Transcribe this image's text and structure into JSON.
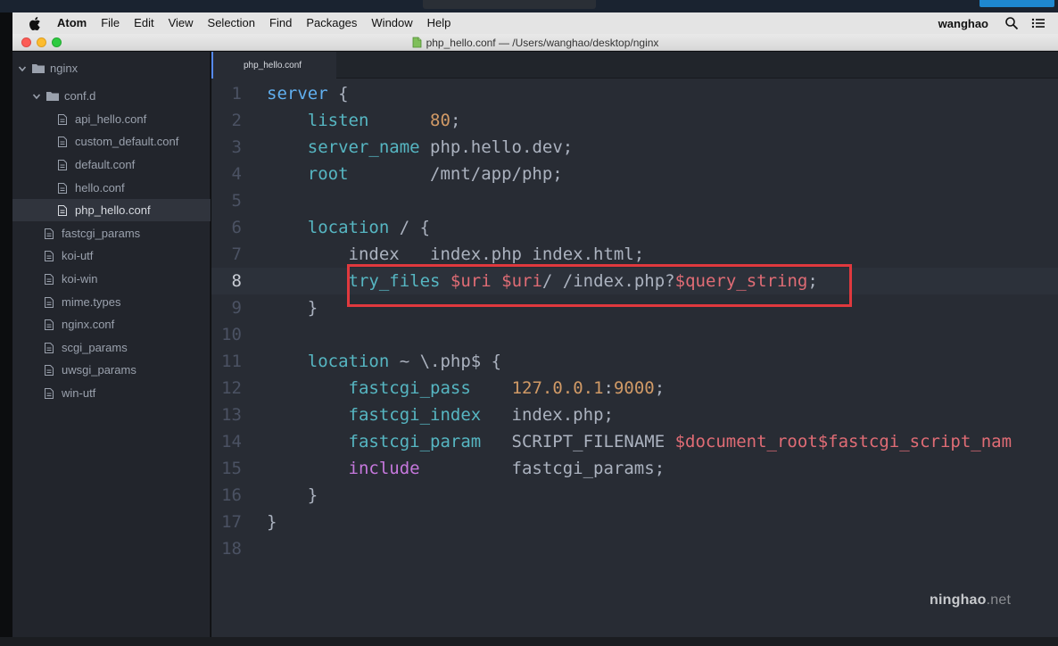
{
  "menubar": {
    "app_name": "Atom",
    "menus": [
      "File",
      "Edit",
      "View",
      "Selection",
      "Find",
      "Packages",
      "Window",
      "Help"
    ],
    "user": "wanghao",
    "icons": [
      "apple-icon",
      "search-icon",
      "list-icon"
    ]
  },
  "window": {
    "title": "php_hello.conf — /Users/wanghao/desktop/nginx"
  },
  "tree": {
    "root": "nginx",
    "folder": "conf.d",
    "conf_d_files": [
      "api_hello.conf",
      "custom_default.conf",
      "default.conf",
      "hello.conf",
      "php_hello.conf"
    ],
    "selected": "php_hello.conf",
    "root_files": [
      "fastcgi_params",
      "koi-utf",
      "koi-win",
      "mime.types",
      "nginx.conf",
      "scgi_params",
      "uwsgi_params",
      "win-utf"
    ]
  },
  "editor": {
    "tab_title": "php_hello.conf",
    "current_line": 8,
    "highlighted_line": 8,
    "colors": {
      "keyword": "#61afef",
      "directive": "#56b6c2",
      "number": "#d19a66",
      "variable": "#e06c75",
      "include": "#c678dd",
      "plain": "#abb2bf",
      "highlight_box": "#e0393e"
    },
    "lines": [
      {
        "n": "1",
        "tokens": [
          [
            "k-blue",
            "server"
          ],
          [
            "k-plain",
            " {"
          ]
        ]
      },
      {
        "n": "2",
        "tokens": [
          [
            "k-plain",
            "    "
          ],
          [
            "k-cyan",
            "listen"
          ],
          [
            "k-plain",
            "      "
          ],
          [
            "k-orange",
            "80"
          ],
          [
            "k-plain",
            ";"
          ]
        ]
      },
      {
        "n": "3",
        "tokens": [
          [
            "k-plain",
            "    "
          ],
          [
            "k-cyan",
            "server_name"
          ],
          [
            "k-plain",
            " php.hello.dev;"
          ]
        ]
      },
      {
        "n": "4",
        "tokens": [
          [
            "k-plain",
            "    "
          ],
          [
            "k-cyan",
            "root"
          ],
          [
            "k-plain",
            "        /mnt/app/php;"
          ]
        ]
      },
      {
        "n": "5",
        "tokens": []
      },
      {
        "n": "6",
        "tokens": [
          [
            "k-plain",
            "    "
          ],
          [
            "k-cyan",
            "location"
          ],
          [
            "k-plain",
            " / {"
          ]
        ]
      },
      {
        "n": "7",
        "tokens": [
          [
            "k-plain",
            "        index   index.php index.html;"
          ]
        ]
      },
      {
        "n": "8",
        "tokens": [
          [
            "k-plain",
            "        "
          ],
          [
            "k-cyan",
            "try_files"
          ],
          [
            "k-plain",
            " "
          ],
          [
            "k-red",
            "$uri"
          ],
          [
            "k-plain",
            " "
          ],
          [
            "k-red",
            "$uri"
          ],
          [
            "k-plain",
            "/ /index.php?"
          ],
          [
            "k-red",
            "$query_string"
          ],
          [
            "k-plain",
            ";"
          ]
        ]
      },
      {
        "n": "9",
        "tokens": [
          [
            "k-plain",
            "    }"
          ]
        ]
      },
      {
        "n": "10",
        "tokens": []
      },
      {
        "n": "11",
        "tokens": [
          [
            "k-plain",
            "    "
          ],
          [
            "k-cyan",
            "location"
          ],
          [
            "k-plain",
            " ~ \\.php$ {"
          ]
        ]
      },
      {
        "n": "12",
        "tokens": [
          [
            "k-plain",
            "        "
          ],
          [
            "k-cyan",
            "fastcgi_pass"
          ],
          [
            "k-plain",
            "    "
          ],
          [
            "k-orange",
            "127.0.0.1"
          ],
          [
            "k-plain",
            ":"
          ],
          [
            "k-orange",
            "9000"
          ],
          [
            "k-plain",
            ";"
          ]
        ]
      },
      {
        "n": "13",
        "tokens": [
          [
            "k-plain",
            "        "
          ],
          [
            "k-cyan",
            "fastcgi_index"
          ],
          [
            "k-plain",
            "   index.php;"
          ]
        ]
      },
      {
        "n": "14",
        "tokens": [
          [
            "k-plain",
            "        "
          ],
          [
            "k-cyan",
            "fastcgi_param"
          ],
          [
            "k-plain",
            "   SCRIPT_FILENAME "
          ],
          [
            "k-red",
            "$document_root$fastcgi_script_nam"
          ]
        ]
      },
      {
        "n": "15",
        "tokens": [
          [
            "k-plain",
            "        "
          ],
          [
            "k-purple",
            "include"
          ],
          [
            "k-plain",
            "         fastcgi_params;"
          ]
        ]
      },
      {
        "n": "16",
        "tokens": [
          [
            "k-plain",
            "    }"
          ]
        ]
      },
      {
        "n": "17",
        "tokens": [
          [
            "k-plain",
            "}"
          ]
        ]
      },
      {
        "n": "18",
        "tokens": []
      }
    ]
  },
  "watermark": {
    "brand": "ninghao",
    "suffix": ".net"
  }
}
